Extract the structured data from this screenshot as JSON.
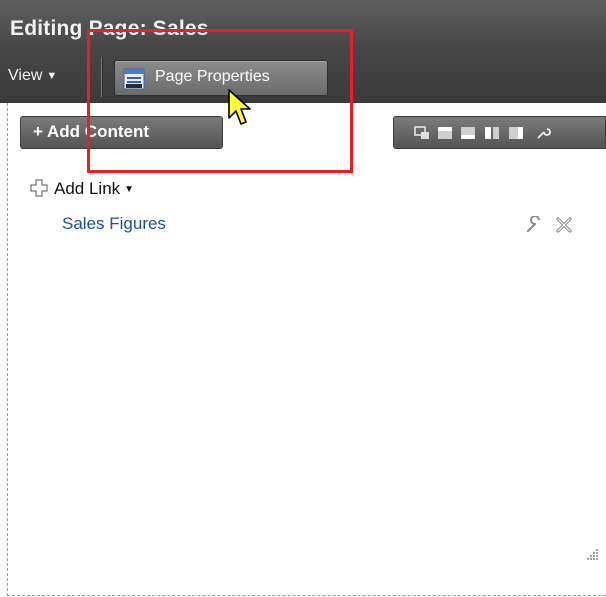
{
  "header": {
    "title": "Editing Page: Sales",
    "view_menu_label": "View",
    "page_properties_label": "Page Properties"
  },
  "toolbar": {
    "add_content_label": "+ Add Content"
  },
  "content": {
    "add_link_label": "Add Link",
    "link_label": "Sales Figures"
  },
  "colors": {
    "header_bg": "#474747",
    "highlight_border": "#e52028",
    "link_color": "#1f4e9c",
    "cursor_fill": "#ffff33"
  },
  "icons": [
    "caret-down-icon",
    "page-properties-icon",
    "layout-icons",
    "plus-outline-icon",
    "wrench-icon",
    "close-icon",
    "resize-grip-icon",
    "mouse-cursor-icon"
  ]
}
